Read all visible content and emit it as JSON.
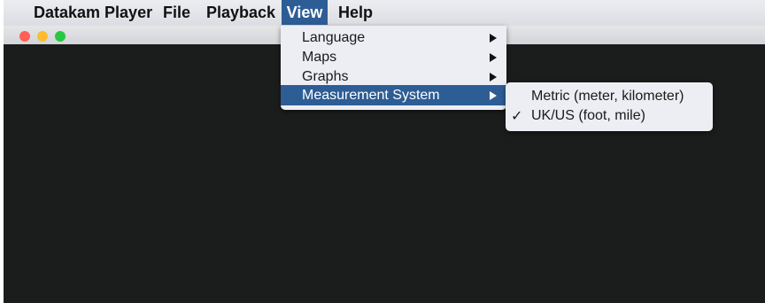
{
  "menubar": {
    "app_name": "Datakam Player",
    "file": "File",
    "playback": "Playback",
    "view": "View",
    "help": "Help"
  },
  "window": {
    "traffic_lights": [
      "close",
      "minimize",
      "zoom"
    ],
    "colors": {
      "close": "#fe5f57",
      "minimize": "#febc2e",
      "zoom": "#28c840",
      "content_background": "#1b1c1c",
      "selection": "#2d5d95"
    }
  },
  "view_menu": {
    "items": [
      {
        "label": "Language",
        "has_submenu": true,
        "selected": false
      },
      {
        "label": "Maps",
        "has_submenu": true,
        "selected": false
      },
      {
        "label": "Graphs",
        "has_submenu": true,
        "selected": false
      },
      {
        "label": "Measurement System",
        "has_submenu": true,
        "selected": true
      }
    ]
  },
  "measurement_submenu": {
    "items": [
      {
        "label": "Metric (meter, kilometer)",
        "checked": false,
        "check_mark": ""
      },
      {
        "label": "UK/US (foot, mile)",
        "checked": true,
        "check_mark": "✓"
      }
    ]
  }
}
